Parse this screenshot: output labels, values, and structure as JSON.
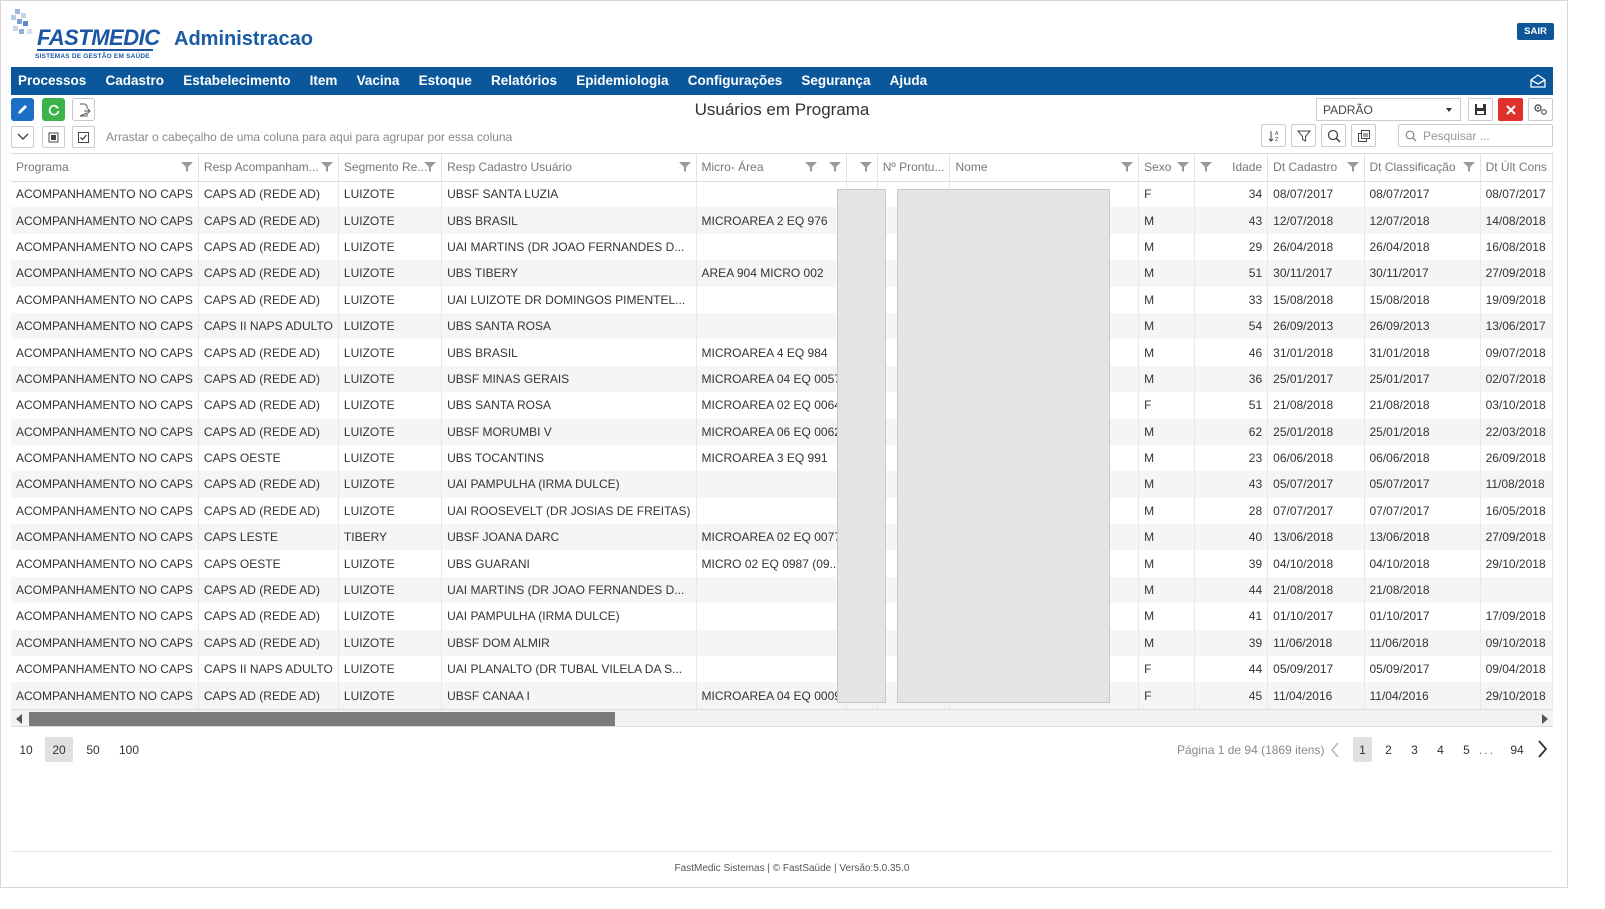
{
  "header": {
    "logo_text": "FASTMEDIC",
    "logo_tagline": "SISTEMAS DE GESTÃO EM SAÚDE",
    "app_title": "Administracao",
    "logout_label": "SAIR"
  },
  "nav": {
    "items": [
      "Processos",
      "Cadastro",
      "Estabelecimento",
      "Item",
      "Vacina",
      "Estoque",
      "Relatórios",
      "Epidemiologia",
      "Configurações",
      "Segurança",
      "Ajuda"
    ],
    "mail_icon": "envelope-icon"
  },
  "toolbar": {
    "page_title": "Usuários em Programa",
    "layout_value": "PADRÃO",
    "group_hint": "Arrastar o cabeçalho de uma coluna para aqui para agrupar por essa coluna",
    "search_placeholder": "Pesquisar ..."
  },
  "colors": {
    "brand": "#0a579c",
    "edit_button": "#1d6fc5",
    "refresh_button": "#3bb34a",
    "close_button": "#e0302c"
  },
  "grid": {
    "columns": [
      "Programa",
      "Resp Acompanham...",
      "Segmento Re...",
      "Resp Cadastro Usuário",
      "Micro- Área",
      "",
      "Nº Prontu...",
      "Nome",
      "Sexo",
      "Idade",
      "Dt Cadastro",
      "Dt Classificação",
      "Dt Últ Cons"
    ],
    "rows": [
      [
        "ACOMPANHAMENTO NO CAPS",
        "CAPS AD (REDE AD)",
        "LUIZOTE",
        "UBSF SANTA LUZIA",
        "",
        "F",
        "34",
        "08/07/2017",
        "08/07/2017",
        "08/07/2017"
      ],
      [
        "ACOMPANHAMENTO NO CAPS",
        "CAPS AD (REDE AD)",
        "LUIZOTE",
        "UBS BRASIL",
        "MICROAREA 2 EQ 976",
        "M",
        "43",
        "12/07/2018",
        "12/07/2018",
        "14/08/2018"
      ],
      [
        "ACOMPANHAMENTO NO CAPS",
        "CAPS AD (REDE AD)",
        "LUIZOTE",
        "UAI MARTINS (DR JOAO FERNANDES D...",
        "",
        "M",
        "29",
        "26/04/2018",
        "26/04/2018",
        "16/08/2018"
      ],
      [
        "ACOMPANHAMENTO NO CAPS",
        "CAPS AD (REDE AD)",
        "LUIZOTE",
        "UBS TIBERY",
        "AREA 904 MICRO 002",
        "M",
        "51",
        "30/11/2017",
        "30/11/2017",
        "27/09/2018"
      ],
      [
        "ACOMPANHAMENTO NO CAPS",
        "CAPS AD (REDE AD)",
        "LUIZOTE",
        "UAI LUIZOTE DR DOMINGOS PIMENTEL...",
        "",
        "M",
        "33",
        "15/08/2018",
        "15/08/2018",
        "19/09/2018"
      ],
      [
        "ACOMPANHAMENTO NO CAPS",
        "CAPS II NAPS ADULTO",
        "LUIZOTE",
        "UBS SANTA ROSA",
        "",
        "M",
        "54",
        "26/09/2013",
        "26/09/2013",
        "13/06/2017"
      ],
      [
        "ACOMPANHAMENTO NO CAPS",
        "CAPS AD (REDE AD)",
        "LUIZOTE",
        "UBS BRASIL",
        "MICROAREA 4 EQ 984",
        "M",
        "46",
        "31/01/2018",
        "31/01/2018",
        "09/07/2018"
      ],
      [
        "ACOMPANHAMENTO NO CAPS",
        "CAPS AD (REDE AD)",
        "LUIZOTE",
        "UBSF MINAS GERAIS",
        "MICROAREA 04 EQ 0057",
        "M",
        "36",
        "25/01/2017",
        "25/01/2017",
        "02/07/2018"
      ],
      [
        "ACOMPANHAMENTO NO CAPS",
        "CAPS AD (REDE AD)",
        "LUIZOTE",
        "UBS SANTA ROSA",
        "MICROAREA 02 EQ 0064",
        "F",
        "51",
        "21/08/2018",
        "21/08/2018",
        "03/10/2018"
      ],
      [
        "ACOMPANHAMENTO NO CAPS",
        "CAPS AD (REDE AD)",
        "LUIZOTE",
        "UBSF MORUMBI V",
        "MICROAREA 06 EQ 0062",
        "M",
        "62",
        "25/01/2018",
        "25/01/2018",
        "22/03/2018"
      ],
      [
        "ACOMPANHAMENTO NO CAPS",
        "CAPS OESTE",
        "LUIZOTE",
        "UBS TOCANTINS",
        "MICROAREA 3 EQ 991",
        "M",
        "23",
        "06/06/2018",
        "06/06/2018",
        "26/09/2018"
      ],
      [
        "ACOMPANHAMENTO NO CAPS",
        "CAPS AD (REDE AD)",
        "LUIZOTE",
        "UAI PAMPULHA (IRMA DULCE)",
        "",
        "M",
        "43",
        "05/07/2017",
        "05/07/2017",
        "11/08/2018"
      ],
      [
        "ACOMPANHAMENTO NO CAPS",
        "CAPS AD (REDE AD)",
        "LUIZOTE",
        "UAI ROOSEVELT (DR JOSIAS DE FREITAS)",
        "",
        "M",
        "28",
        "07/07/2017",
        "07/07/2017",
        "16/05/2018"
      ],
      [
        "ACOMPANHAMENTO NO CAPS",
        "CAPS LESTE",
        "TIBERY",
        "UBSF JOANA DARC",
        "MICROAREA 02 EQ 0077",
        "M",
        "40",
        "13/06/2018",
        "13/06/2018",
        "27/09/2018"
      ],
      [
        "ACOMPANHAMENTO NO CAPS",
        "CAPS OESTE",
        "LUIZOTE",
        "UBS GUARANI",
        "MICRO 02 EQ 0987 (09...",
        "M",
        "39",
        "04/10/2018",
        "04/10/2018",
        "29/10/2018"
      ],
      [
        "ACOMPANHAMENTO NO CAPS",
        "CAPS AD (REDE AD)",
        "LUIZOTE",
        "UAI MARTINS (DR JOAO FERNANDES D...",
        "",
        "M",
        "44",
        "21/08/2018",
        "21/08/2018",
        ""
      ],
      [
        "ACOMPANHAMENTO NO CAPS",
        "CAPS AD (REDE AD)",
        "LUIZOTE",
        "UAI PAMPULHA (IRMA DULCE)",
        "",
        "M",
        "41",
        "01/10/2017",
        "01/10/2017",
        "17/09/2018"
      ],
      [
        "ACOMPANHAMENTO NO CAPS",
        "CAPS AD (REDE AD)",
        "LUIZOTE",
        "UBSF DOM ALMIR",
        "",
        "M",
        "39",
        "11/06/2018",
        "11/06/2018",
        "09/10/2018"
      ],
      [
        "ACOMPANHAMENTO NO CAPS",
        "CAPS II NAPS ADULTO",
        "LUIZOTE",
        "UAI PLANALTO (DR TUBAL VILELA DA S...",
        "",
        "F",
        "44",
        "05/09/2017",
        "05/09/2017",
        "09/04/2018"
      ],
      [
        "ACOMPANHAMENTO NO CAPS",
        "CAPS AD (REDE AD)",
        "LUIZOTE",
        "UBSF CANAA I",
        "MICROAREA 04 EQ 0009",
        "F",
        "45",
        "11/04/2016",
        "11/04/2016",
        "29/10/2018"
      ]
    ]
  },
  "pager": {
    "page_sizes": [
      "10",
      "20",
      "50",
      "100"
    ],
    "active_page_size": "20",
    "info": "Página 1 de 94 (1869 itens)",
    "pages": [
      "1",
      "2",
      "3",
      "4",
      "5"
    ],
    "ellipsis": "...",
    "last_page": "94"
  },
  "footer": {
    "text": "FastMedic Sistemas | © FastSaúde | Versão:5.0.35.0"
  }
}
